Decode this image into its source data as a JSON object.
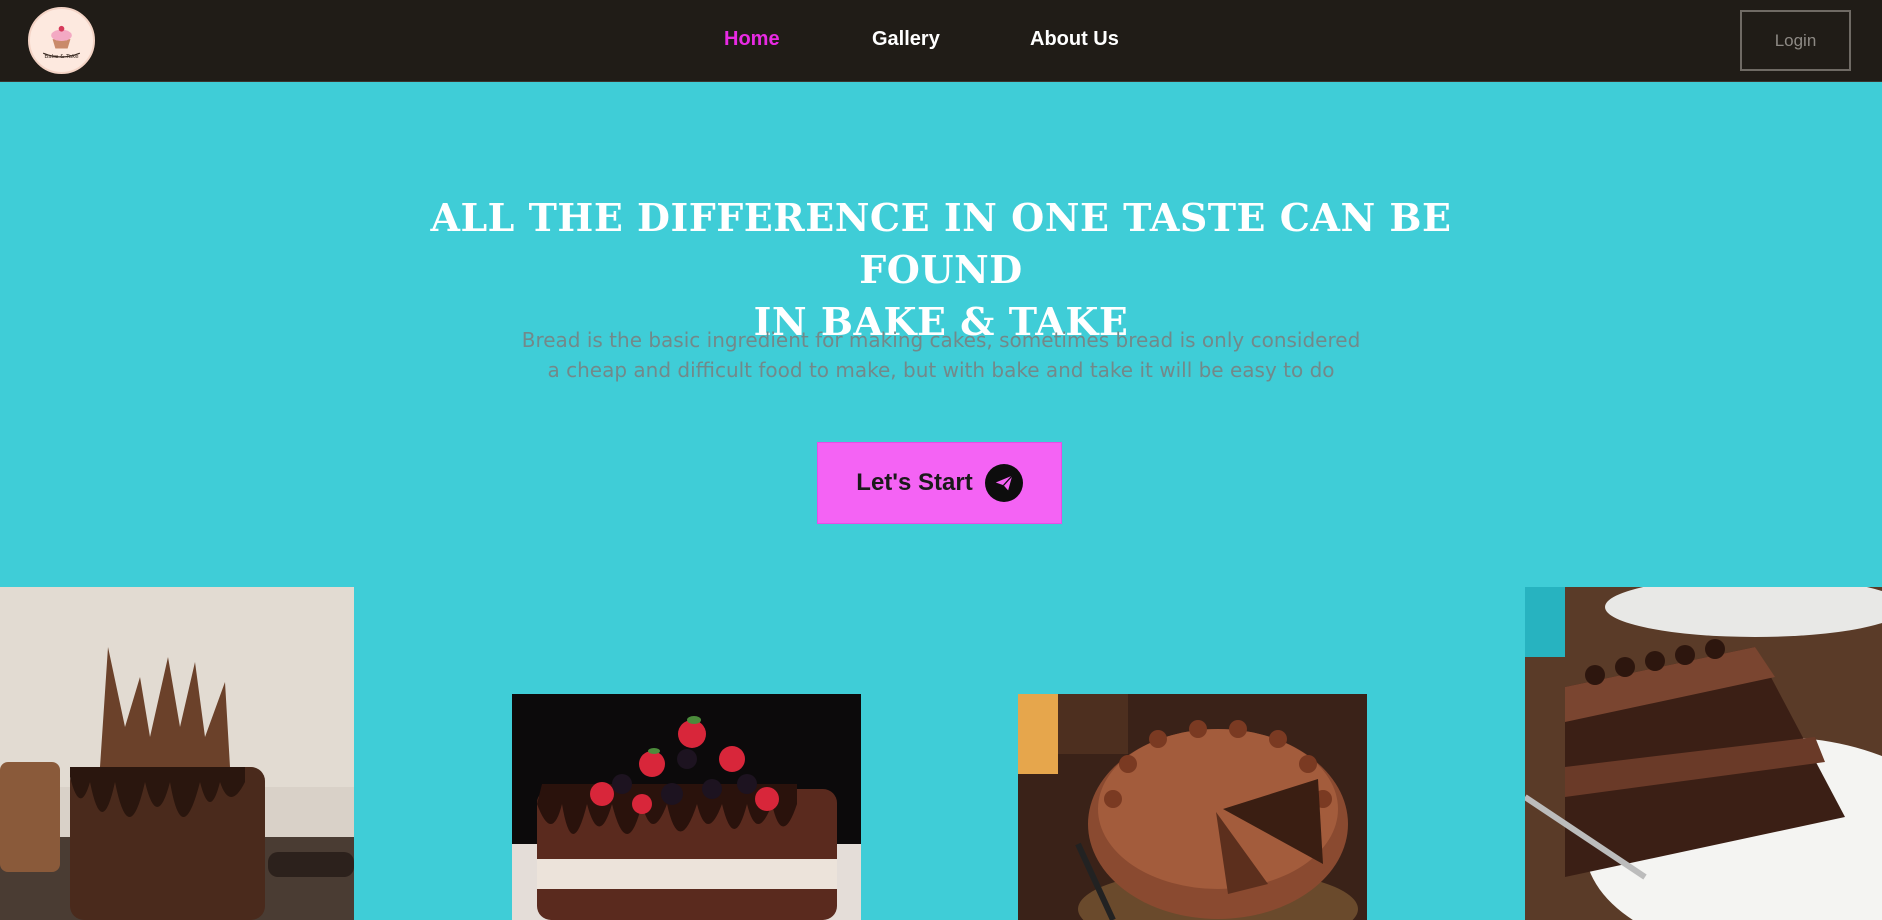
{
  "navbar": {
    "logo_text": "Bake & Take",
    "links": [
      {
        "label": "Home",
        "active": true
      },
      {
        "label": "Gallery",
        "active": false
      },
      {
        "label": "About Us",
        "active": false
      }
    ],
    "login_label": "Login"
  },
  "hero": {
    "title_line1": "ALL THE DIFFERENCE IN ONE TASTE CAN BE FOUND",
    "title_line2": "IN BAKE & TAKE",
    "subtitle_line1": "Bread is the basic ingredient for making cakes, sometimes bread is only considered",
    "subtitle_line2": "a cheap and difficult food to make, but with bake and take it will be easy to do",
    "cta_label": "Let's Start",
    "cta_icon": "paper-plane-icon"
  },
  "gallery": [
    {
      "name": "chocolate-drip-cake-image"
    },
    {
      "name": "berry-chocolate-naked-cake-image"
    },
    {
      "name": "chocolate-frosted-round-cake-image"
    },
    {
      "name": "chocolate-cake-slice-image"
    }
  ],
  "colors": {
    "background": "#3fcdd7",
    "navbar": "#201c17",
    "active_link": "#e82ae3",
    "cta": "#f463f4",
    "subtitle": "#72898a"
  }
}
